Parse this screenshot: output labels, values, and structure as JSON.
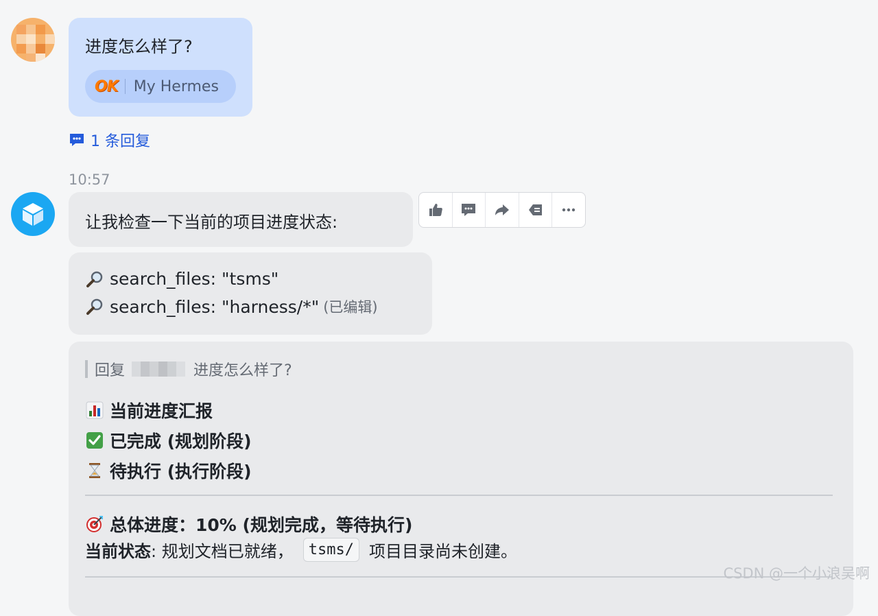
{
  "user_message": {
    "text": "进度怎么样了?",
    "chip_brand": "OK",
    "chip_name": "My Hermes"
  },
  "reply_count_label": "1 条回复",
  "timestamp": "10:57",
  "bot_message_1": {
    "text": "让我检查一下当前的项目进度状态:"
  },
  "toolbar": {
    "items": [
      "thumbs-up-icon",
      "comment-icon",
      "forward-icon",
      "reply-icon",
      "more-icon"
    ]
  },
  "bot_message_2": {
    "lines": [
      {
        "icon": "magnifier-icon",
        "text": "search_files: \"tsms\""
      },
      {
        "icon": "magnifier-icon",
        "text": "search_files: \"harness/*\""
      }
    ],
    "edited_label": "(已编辑)"
  },
  "bot_message_3": {
    "quote_prefix": "回复",
    "quote_text": "进度怎么样了?",
    "headings": [
      {
        "icon": "bar-chart-icon",
        "text": "当前进度汇报"
      },
      {
        "icon": "check-mark-icon",
        "text": "已完成 (规划阶段)"
      },
      {
        "icon": "hourglass-icon",
        "text": "待执行 (执行阶段)"
      }
    ],
    "overall": {
      "icon": "target-icon",
      "text": "总体进度：10% (规划完成，等待执行)"
    },
    "status_label": "当前状态",
    "status_before": ": 规划文档已就绪，",
    "status_code": "tsms/",
    "status_after": "项目目录尚未创建。"
  },
  "watermark": "CSDN @一个小浪吴啊",
  "colors": {
    "user_bubble": "#cfe0fd",
    "bot_bubble": "#e9eaec",
    "link_blue": "#245bdb",
    "bot_avatar": "#1ba7f2"
  }
}
